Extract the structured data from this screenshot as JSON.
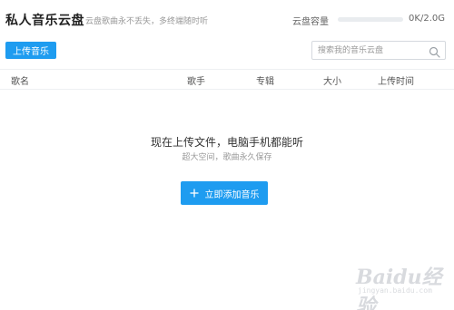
{
  "header": {
    "title": "私人音乐云盘",
    "subtitle": "云盘歌曲永不丢失，多终端随时听",
    "capacity_label": "云盘容量",
    "capacity_value": "0K/2.0G",
    "capacity_fraction": 0
  },
  "toolbar": {
    "upload_label": "上传音乐",
    "search_placeholder": "搜索我的音乐云盘"
  },
  "table": {
    "columns": [
      "歌名",
      "歌手",
      "专辑",
      "大小",
      "上传时间"
    ]
  },
  "empty_state": {
    "title": "现在上传文件，电脑手机都能听",
    "subtitle": "超大空间，歌曲永久保存",
    "add_button_label": "立即添加音乐"
  },
  "watermark": {
    "logo_text": "Baidu经验",
    "url": "jingyan.baidu.com"
  },
  "colors": {
    "accent": "#1e9cf0"
  },
  "icons": {
    "search": "search-icon",
    "add": "plus-icon"
  }
}
